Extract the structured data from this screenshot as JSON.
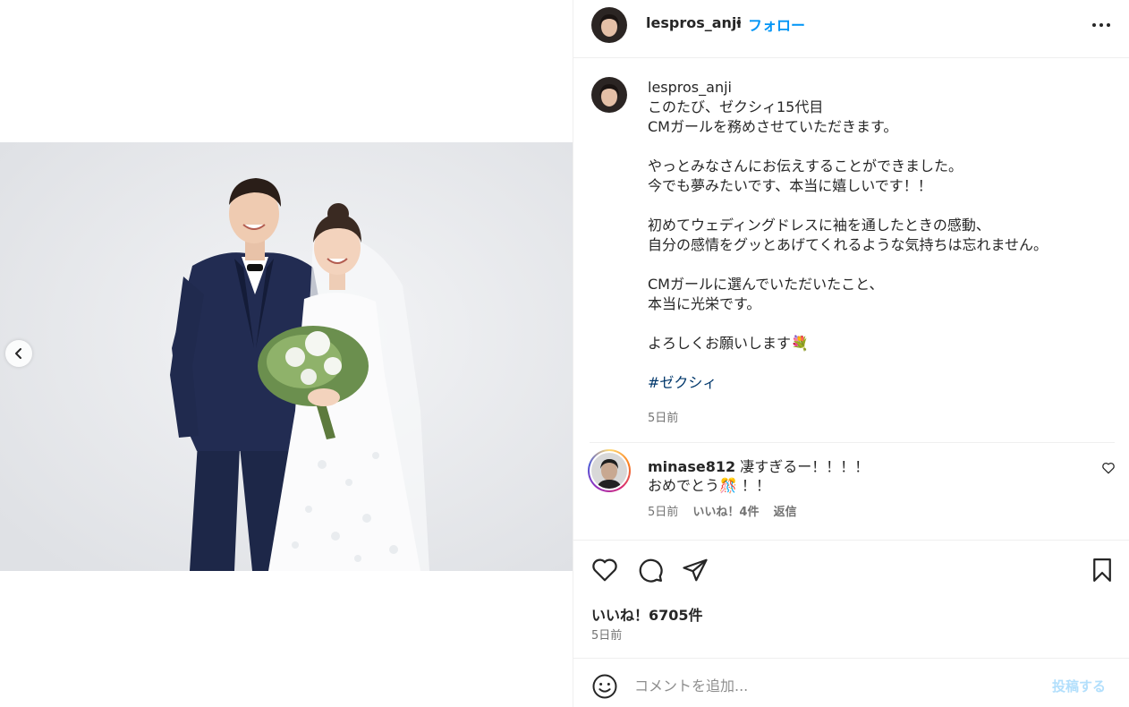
{
  "post": {
    "username": "lespros_anji",
    "separator": "•",
    "follow_label": "フォロー",
    "more_icon": "more-horizontal-icon"
  },
  "caption": {
    "username": "lespros_anji",
    "lines": [
      "このたび、ゼクシィ15代目",
      "CMガールを務めさせていただきます。",
      "",
      "やっとみなさんにお伝えすることができました。",
      "今でも夢みたいです、本当に嬉しいです！！",
      "",
      "初めてウェディングドレスに袖を通したときの感動、",
      "自分の感情をグッとあげてくれるような気持ちは忘れません。",
      "",
      "CMガールに選んでいただいたこと、",
      "本当に光栄です。",
      "",
      "よろしくお願いします💐"
    ],
    "hashtag": "#ゼクシィ",
    "time": "5日前"
  },
  "comment": {
    "username": "minase812",
    "text_line1": "凄すぎるー！！！！",
    "text_line2": "おめでとう🎊 ！！",
    "time": "5日前",
    "likes": "いいね！4件",
    "reply": "返信"
  },
  "actions": {
    "like_icon": "heart-icon",
    "comment_icon": "comment-icon",
    "share_icon": "send-icon",
    "save_icon": "bookmark-icon"
  },
  "stats": {
    "likes": "いいね！6705件",
    "time": "5日前"
  },
  "composer": {
    "placeholder": "コメントを追加...",
    "post_label": "投稿する"
  },
  "colors": {
    "link_blue": "#0095f6",
    "hashtag": "#00376b",
    "muted": "#737373",
    "post_disabled": "#b2dffc"
  }
}
